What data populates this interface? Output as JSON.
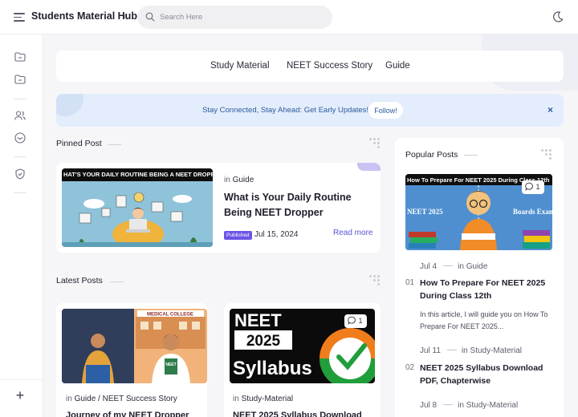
{
  "header": {
    "site_title": "Students Material Hub",
    "search_placeholder": "Search Here"
  },
  "nav": {
    "links": [
      "Study Material",
      "NEET Success Story",
      "Guide"
    ]
  },
  "banner": {
    "text": "Stay Connected, Stay Ahead: Get Early Updates!",
    "follow_label": "Follow!",
    "close_label": "×"
  },
  "pinned": {
    "section_title": "Pinned Post",
    "image_caption": "HAT'S YOUR DAILY ROUTINE BEING A NEET DROPPE",
    "in_label": "in",
    "category": "Guide",
    "title": "What is Your Daily Routine Being NEET Dropper",
    "badge": "Published",
    "date": "Jul 15, 2024",
    "read_more": "Read more"
  },
  "latest": {
    "section_title": "Latest Posts",
    "posts": [
      {
        "in_label": "in",
        "category": "Guide / NEET Success Story",
        "title": "Journey of my NEET Dropper",
        "image_sign": "MEDICAL COLLEGE",
        "image_book": "NEET"
      },
      {
        "in_label": "in",
        "category": "Study-Material",
        "title": "NEET 2025 Syllabus Download",
        "comments": "1",
        "image_line1": "NEET",
        "image_line2": "2025",
        "image_line3": "Syllabus"
      }
    ]
  },
  "popular": {
    "section_title": "Popular Posts",
    "image_caption": "How To Prepare For NEET 2025 During Class 12th",
    "image_left": "NEET 2025",
    "image_right": "Boards Exam",
    "comments": "1",
    "posts": [
      {
        "date": "Jul 4",
        "in_label": "in",
        "category": "Guide",
        "num": "01",
        "title": "How To Prepare For NEET 2025 During Class 12th",
        "excerpt": "In this article, I will guide you on How To Prepare For NEET 2025..."
      },
      {
        "date": "Jul 11",
        "in_label": "in",
        "category": "Study-Material",
        "num": "02",
        "title": "NEET 2025 Syllabus Download PDF, Chapterwise"
      },
      {
        "date": "Jul 8",
        "in_label": "in",
        "category": "Study-Material"
      }
    ]
  },
  "colors": {
    "accent": "#5b53d6",
    "badge": "#6b55e6",
    "banner_bg": "#e3edfb",
    "banner_text": "#2b5aa0",
    "page_bg": "#f6f6f9"
  },
  "icons": {
    "header": [
      "menu-icon",
      "search-icon",
      "moon-icon"
    ],
    "sidebar": [
      "folder-icon",
      "folder-icon",
      "users-icon",
      "inbox-icon",
      "shield-icon",
      "plus-icon"
    ]
  }
}
